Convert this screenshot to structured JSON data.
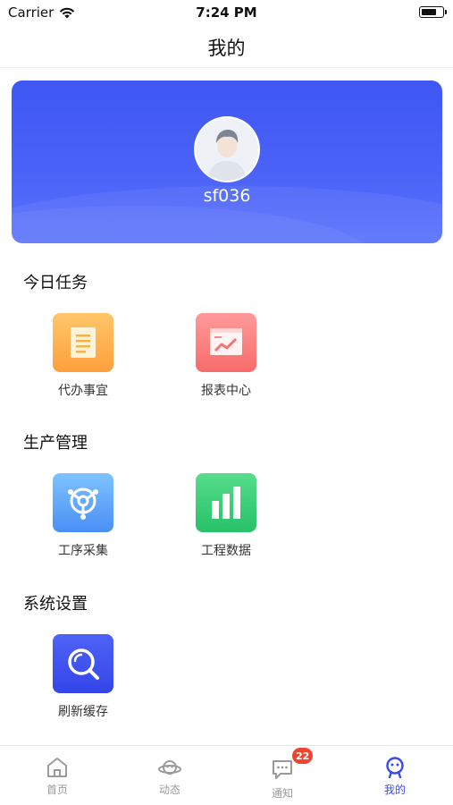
{
  "status_bar": {
    "carrier": "Carrier",
    "time": "7:24 PM",
    "battery_level": 0.75
  },
  "nav": {
    "title": "我的"
  },
  "profile": {
    "username": "sf036"
  },
  "sections": {
    "today": {
      "title": "今日任务",
      "items": [
        {
          "label": "代办事宜",
          "icon": "document-icon"
        },
        {
          "label": "报表中心",
          "icon": "report-chart-icon"
        }
      ]
    },
    "production": {
      "title": "生产管理",
      "items": [
        {
          "label": "工序采集",
          "icon": "process-node-icon"
        },
        {
          "label": "工程数据",
          "icon": "bar-chart-icon"
        }
      ]
    },
    "settings": {
      "title": "系统设置",
      "items": [
        {
          "label": "刷新缓存",
          "icon": "search-icon"
        }
      ]
    }
  },
  "tab_bar": {
    "tabs": [
      {
        "label": "首页",
        "icon": "home-icon"
      },
      {
        "label": "动态",
        "icon": "planet-icon"
      },
      {
        "label": "通知",
        "icon": "message-icon",
        "badge": "22"
      },
      {
        "label": "我的",
        "icon": "profile-icon",
        "active": true
      }
    ]
  },
  "colors": {
    "accent": "#3a4be8",
    "badge": "#f0442f",
    "card": "#4a62f8"
  }
}
